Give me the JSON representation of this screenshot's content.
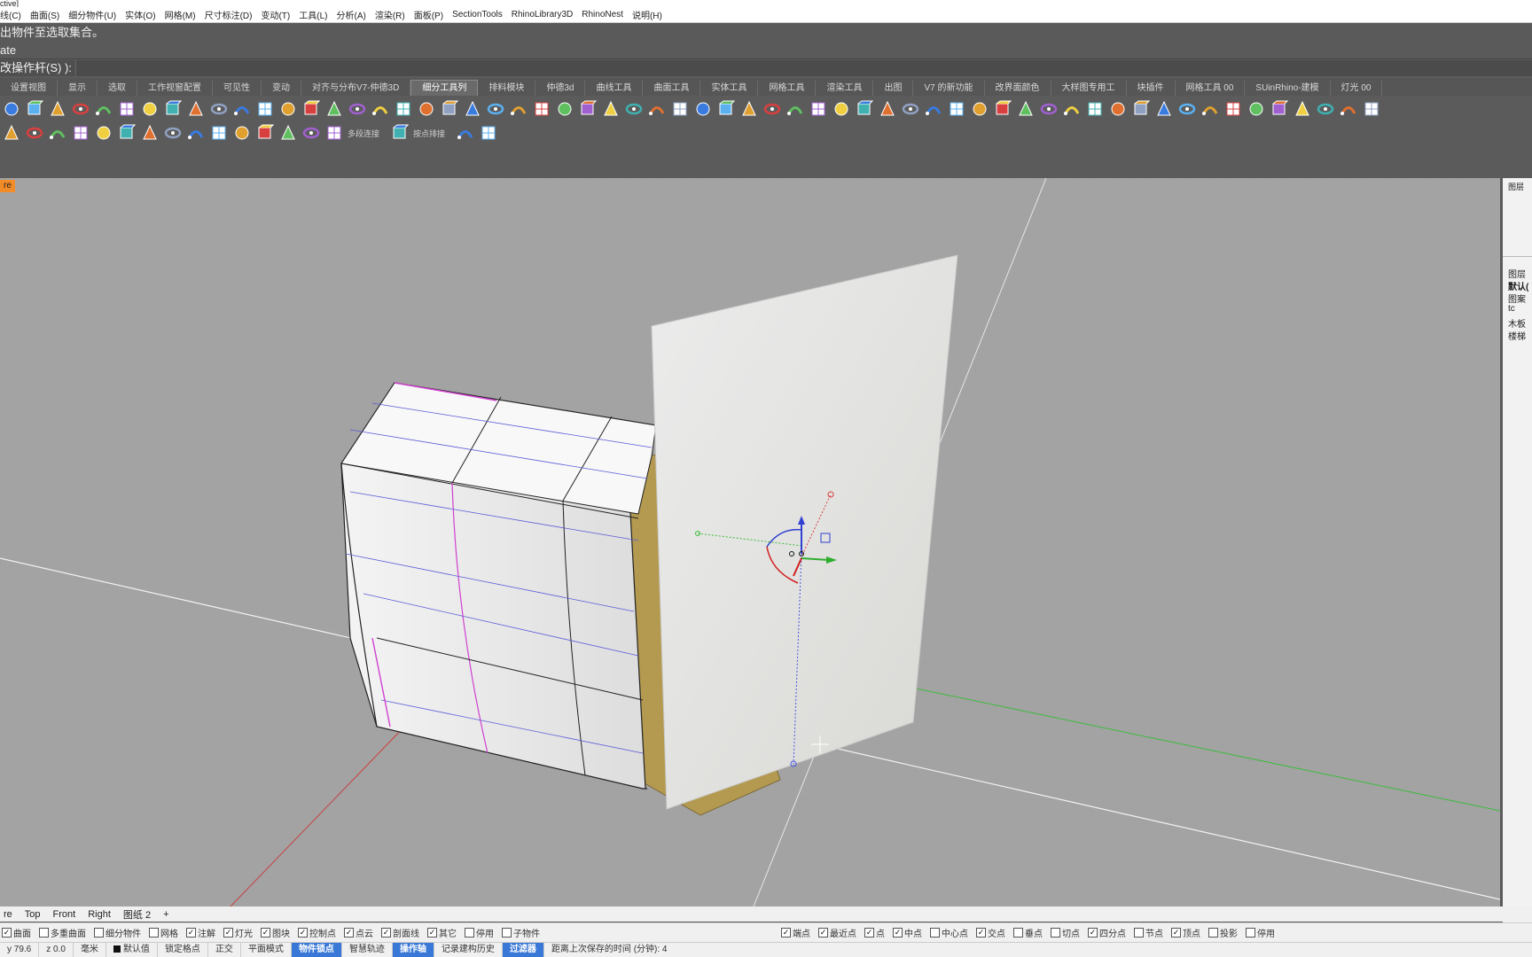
{
  "title_fragment": "ctive]",
  "menu": [
    "线(C)",
    "曲面(S)",
    "细分物件(U)",
    "实体(O)",
    "网格(M)",
    "尺寸标注(D)",
    "变动(T)",
    "工具(L)",
    "分析(A)",
    "渲染(R)",
    "面板(P)",
    "SectionTools",
    "RhinoLibrary3D",
    "RhinoNest",
    "说明(H)"
  ],
  "command": {
    "history1": "出物件至选取集合。",
    "history2": "ate",
    "prompt": "改操作杆(S) ):"
  },
  "tabs": [
    "设置视图",
    "显示",
    "选取",
    "工作视窗配置",
    "可见性",
    "变动",
    "对齐与分布V7-仲德3D",
    "细分工具列",
    "排料模块",
    "仲德3d",
    "曲线工具",
    "曲面工具",
    "实体工具",
    "网格工具",
    "渲染工具",
    "出图",
    "V7 的新功能",
    "改界面颜色",
    "大样图专用工",
    "块插件",
    "网格工具 00",
    "SUinRhino-建模",
    "灯光 00"
  ],
  "active_tab": "细分工具列",
  "toolbar1_icons": [
    "sphere-icon",
    "box-icon",
    "cone-icon",
    "cylinder-icon",
    "torus-icon",
    "pipe-icon",
    "loft-icon",
    "extrude-icon",
    "revolve-icon",
    "sweep-icon",
    "network-icon",
    "grid-icon",
    "array-icon",
    "bend-icon",
    "cup-icon",
    "polyline-icon",
    "rect-icon",
    "curve-icon",
    "wire-icon",
    "ellipse-icon",
    "split-icon",
    "fillet-icon",
    "trim-icon",
    "cube-icon",
    "join-icon",
    "explode-icon",
    "mesh-icon",
    "bool-icon",
    "plane-icon",
    "cut-icon",
    "globe-icon",
    "flag-icon",
    "mirror-icon",
    "scale-icon",
    "sphere-green-icon",
    "paint-icon",
    "shield-icon",
    "sub-cube-icon",
    "gem-icon",
    "diamond-icon",
    "hex-icon",
    "brush-icon",
    "pin-icon",
    "pick-icon",
    "magnet-icon",
    "no-entry-icon",
    "panel-icon",
    "search-icon",
    "tripod-icon",
    "leaf-icon",
    "wave-icon",
    "wave2-icon",
    "fan-icon",
    "bracket-icon",
    "shield-orange-icon",
    "t-icon",
    "l-icon",
    "h-icon",
    "download-icon",
    "cake-icon"
  ],
  "toolbar2": {
    "icons": [
      "grid-lines-icon",
      "list-icon",
      "refresh-icon",
      "gear-icon",
      "layers-icon",
      "colors-icon",
      "cogs-icon",
      "panel2-icon",
      "dimension-icon",
      "blocks-icon",
      "stairs-icon",
      "table-icon",
      "star-icon",
      "lamp-icon"
    ],
    "label_a": "多段连接",
    "label_b": "按点排接",
    "icons_end": [
      "bulb-icon",
      "hexagon-icon"
    ]
  },
  "viewport_label": "re",
  "right_panel": [
    "图层",
    "默认(",
    "图案",
    "tc",
    "木板",
    "楼梯"
  ],
  "right_panel_top": "图层",
  "viewport_tabs": [
    "re",
    "Top",
    "Front",
    "Right",
    "图纸 2",
    "+"
  ],
  "osnap_left": [
    {
      "label": "曲面",
      "checked": true
    },
    {
      "label": "多重曲面",
      "checked": false
    },
    {
      "label": "细分物件",
      "checked": false
    },
    {
      "label": "网格",
      "checked": false
    },
    {
      "label": "注解",
      "checked": true
    },
    {
      "label": "灯光",
      "checked": true
    },
    {
      "label": "图块",
      "checked": true
    },
    {
      "label": "控制点",
      "checked": true
    },
    {
      "label": "点云",
      "checked": true
    },
    {
      "label": "剖面线",
      "checked": true
    },
    {
      "label": "其它",
      "checked": true
    },
    {
      "label": "停用",
      "checked": false
    },
    {
      "label": "子物件",
      "checked": false
    }
  ],
  "osnap_right": [
    {
      "label": "端点",
      "checked": true
    },
    {
      "label": "最近点",
      "checked": true
    },
    {
      "label": "点",
      "checked": true
    },
    {
      "label": "中点",
      "checked": true
    },
    {
      "label": "中心点",
      "checked": false
    },
    {
      "label": "交点",
      "checked": true
    },
    {
      "label": "垂点",
      "checked": false
    },
    {
      "label": "切点",
      "checked": false
    },
    {
      "label": "四分点",
      "checked": true
    },
    {
      "label": "节点",
      "checked": false
    },
    {
      "label": "顶点",
      "checked": true
    },
    {
      "label": "投影",
      "checked": false
    },
    {
      "label": "停用",
      "checked": false
    }
  ],
  "status": {
    "y": "y 79.6",
    "z": "z 0.0",
    "units": "毫米",
    "layer": "默认值",
    "items": [
      "锁定格点",
      "正交",
      "平面模式",
      "物件锁点",
      "智慧轨迹",
      "操作轴",
      "记录建构历史",
      "过滤器"
    ],
    "highlighted": [
      "物件锁点",
      "操作轴",
      "过滤器"
    ],
    "message": "距离上次保存的时间 (分钟): 4"
  },
  "colors": {
    "viewport_bg": "#a3a3a3",
    "accent_orange": "#f28c28",
    "status_blue": "#3978d6"
  }
}
